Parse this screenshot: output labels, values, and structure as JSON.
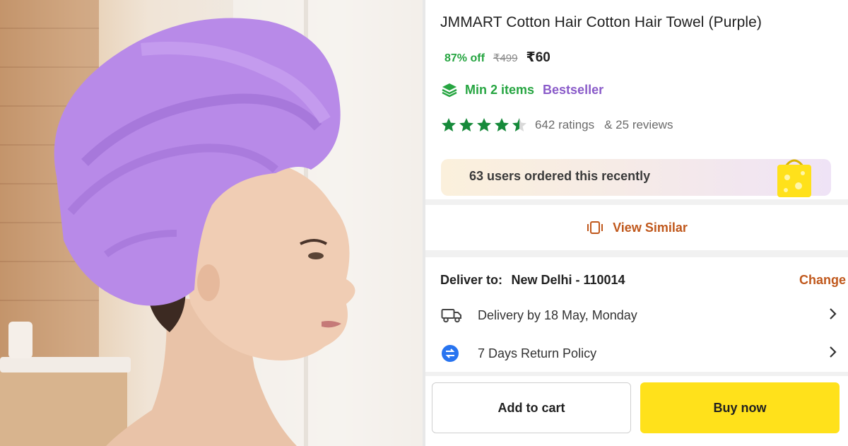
{
  "product": {
    "title": "JMMART Cotton Hair Cotton Hair Towel (Purple)",
    "discount": "87% off",
    "mrp": "₹499",
    "price": "₹60",
    "min_items": "Min 2 items",
    "badge": "Bestseller",
    "rating_value": 4.5,
    "ratings_count": "642 ratings",
    "reviews_count": "& 25 reviews"
  },
  "banner": {
    "text": "63 users ordered this recently"
  },
  "view_similar": {
    "label": "View Similar"
  },
  "delivery": {
    "deliver_to_label": "Deliver to:",
    "location": "New Delhi - 110014",
    "change_label": "Change",
    "delivery_text": "Delivery by 18 May, Monday",
    "return_text": "7 Days Return Policy"
  },
  "actions": {
    "add_to_cart": "Add to cart",
    "buy_now": "Buy now"
  },
  "colors": {
    "green": "#26a541",
    "purple": "#8a5bc9",
    "orange": "#c0581c",
    "buy_yellow": "#ffe11b",
    "towel_purple": "#b88ae8"
  },
  "icons": {
    "offer": "stack-layers-icon",
    "view_similar": "view-similar-icon",
    "delivery": "truck-icon",
    "returns": "return-arrows-icon",
    "chevron": "chevron-right-icon"
  }
}
